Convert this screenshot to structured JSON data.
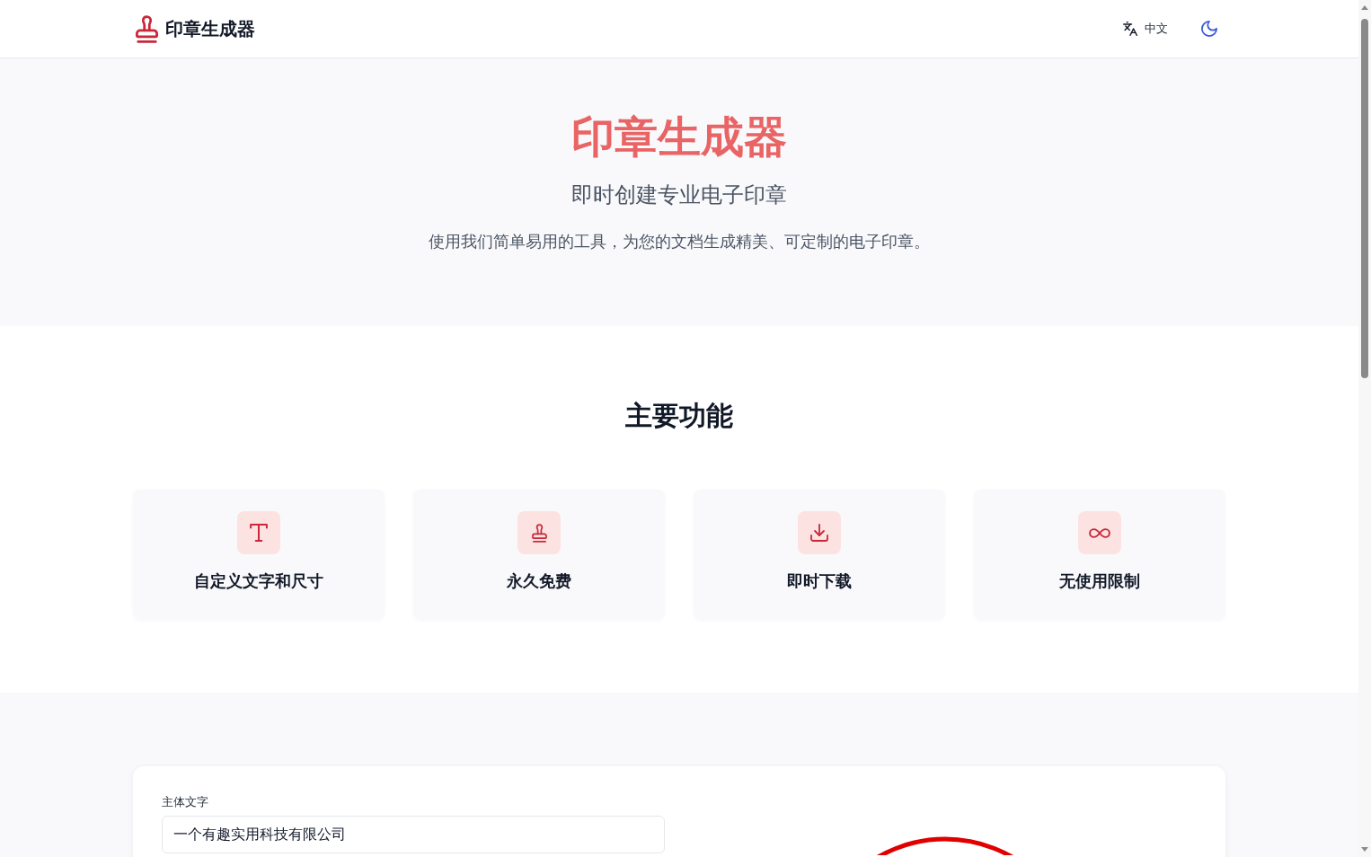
{
  "header": {
    "logo_text": "印章生成器",
    "language": "中文"
  },
  "hero": {
    "title": "印章生成器",
    "subtitle": "即时创建专业电子印章",
    "description": "使用我们简单易用的工具，为您的文档生成精美、可定制的电子印章。"
  },
  "features": {
    "heading": "主要功能",
    "items": [
      {
        "title": "自定义文字和尺寸"
      },
      {
        "title": "永久免费"
      },
      {
        "title": "即时下载"
      },
      {
        "title": "无使用限制"
      }
    ]
  },
  "generator": {
    "main_text": {
      "label": "主体文字",
      "value": "一个有趣实用科技有限公司"
    }
  }
}
